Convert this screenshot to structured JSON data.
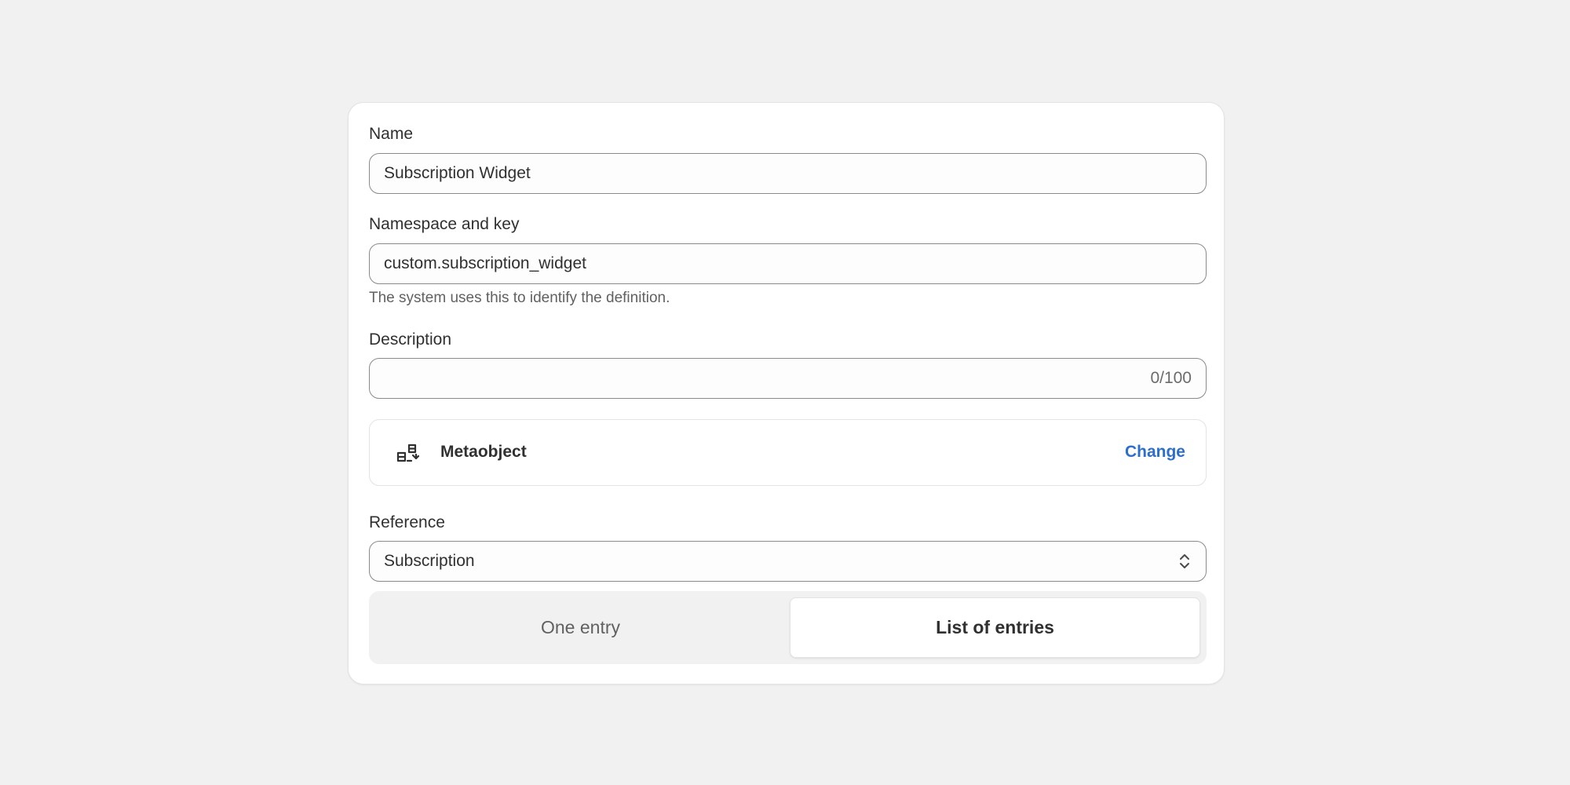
{
  "form": {
    "name_label": "Name",
    "name_value": "Subscription Widget",
    "namespace_label": "Namespace and key",
    "namespace_value": "custom.subscription_widget",
    "namespace_help": "The system uses this to identify the definition.",
    "description_label": "Description",
    "description_value": "",
    "description_counter": "0/100",
    "type": {
      "icon": "metaobject-icon",
      "name": "Metaobject",
      "change_label": "Change"
    },
    "reference_label": "Reference",
    "reference_value": "Subscription",
    "entry_options": [
      {
        "label": "One entry",
        "selected": false
      },
      {
        "label": "List of entries",
        "selected": true
      }
    ]
  },
  "colors": {
    "link": "#2c6ecb",
    "background": "#f1f1f1",
    "card": "#ffffff"
  }
}
